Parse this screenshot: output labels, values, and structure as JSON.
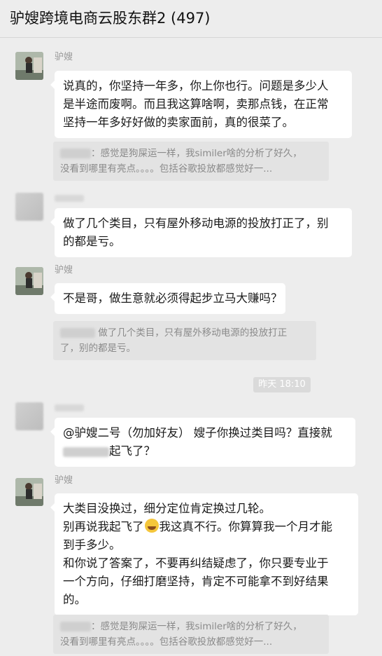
{
  "header": {
    "title": "驴嫂跨境电商云股东群2 (497)"
  },
  "messages": [
    {
      "sender": "驴嫂",
      "lines": [
        "说真的，你坚持一年多，你上你也行。问题是多少人",
        "是半途而废啊。而且我这算啥啊，卖那点钱，在正常",
        "坚持一年多好好做的卖家面前，真的很菜了。"
      ],
      "quote": [
        "：感觉是狗屎运一样，我similer啥的分析了好久，",
        "没看到哪里有亮点。。。。包括谷歌投放都感觉好一..."
      ]
    },
    {
      "sender": "",
      "lines": [
        "做了几个类目，只有屋外移动电源的投放打正了，别",
        "的都是亏。"
      ]
    },
    {
      "sender": "驴嫂",
      "lines": [
        "不是哥，做生意就必须得起步立马大赚吗？"
      ],
      "quote": [
        "做了几个类目，只有屋外移动电源的投放打正",
        "了，别的都是亏。"
      ]
    },
    {
      "timestamp": "昨天 18:10"
    },
    {
      "sender": "",
      "lines": [
        "@驴嫂二号（勿加好友） 嫂子你换过类目吗？直接就",
        "起飞了？"
      ]
    },
    {
      "sender": "驴嫂",
      "lines": [
        "大类目没换过，细分定位肯定换过几轮。",
        "别再说我起飞了",
        "我这真不行。你算算我一个月才能",
        "到手多少。",
        "和你说了答案了，不要再纠结疑虑了，你只要专业于",
        "一个方向，仔细打磨坚持，肯定不可能拿不到好结果",
        "的。"
      ],
      "emoji": "crying-face",
      "quote": [
        "：感觉是狗屎运一样，我similer啥的分析了好久，",
        "没看到哪里有亮点。。。。包括谷歌投放都感觉好一..."
      ]
    }
  ]
}
